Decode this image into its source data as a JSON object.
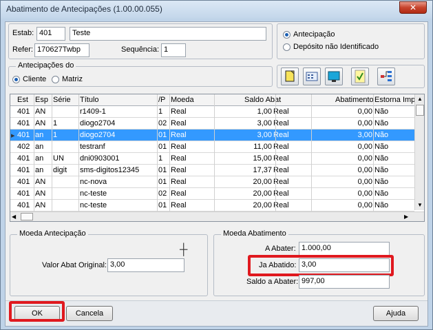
{
  "window": {
    "title": "Abatimento de Antecipações (1.00.00.055)",
    "close_glyph": "✕"
  },
  "header": {
    "estab_label": "Estab:",
    "estab_code": "401",
    "estab_name": "Teste",
    "refer_label": "Refer:",
    "refer_value": "170627Twbp",
    "sequencia_label": "Sequência:",
    "sequencia_value": "1"
  },
  "type_options": [
    {
      "label": "Antecipação",
      "selected": true
    },
    {
      "label": "Depósito não Identificado",
      "selected": false
    }
  ],
  "antecipacoes_do": {
    "title": "Antecipações do",
    "options": [
      {
        "label": "Cliente",
        "selected": true
      },
      {
        "label": "Matriz",
        "selected": false
      }
    ]
  },
  "toolbar": [
    "new-document-icon",
    "calendar-icon",
    "monitor-icon",
    "check-mark-icon",
    "tree-structure-icon"
  ],
  "grid": {
    "columns": [
      "Est",
      "Esp",
      "Série",
      "Título",
      "/P",
      "Moeda",
      "Saldo Abat",
      "Abatimento",
      "Estorna Imp"
    ],
    "rows": [
      [
        "401",
        "AN",
        "",
        "r1409-1",
        "1",
        "Real",
        "1,00",
        "Real",
        "0,00",
        "Não"
      ],
      [
        "401",
        "AN",
        "1",
        "diogo2704",
        "02",
        "Real",
        "3,00",
        "Real",
        "0,00",
        "Não"
      ],
      [
        "401",
        "an",
        "1",
        "diogo2704",
        "01",
        "Real",
        "3,00",
        "Real",
        "3,00",
        "Não"
      ],
      [
        "402",
        "an",
        "",
        "testranf",
        "01",
        "Real",
        "11,00",
        "Real",
        "0,00",
        "Não"
      ],
      [
        "401",
        "an",
        "UN",
        "dni0903001",
        "1",
        "Real",
        "15,00",
        "Real",
        "0,00",
        "Não"
      ],
      [
        "401",
        "an",
        "digit",
        "sms-digitos12345",
        "01",
        "Real",
        "17,37",
        "Real",
        "0,00",
        "Não"
      ],
      [
        "401",
        "AN",
        "",
        "nc-nova",
        "01",
        "Real",
        "20,00",
        "Real",
        "0,00",
        "Não"
      ],
      [
        "401",
        "AN",
        "",
        "nc-teste",
        "02",
        "Real",
        "20,00",
        "Real",
        "0,00",
        "Não"
      ],
      [
        "401",
        "AN",
        "",
        "nc-teste",
        "01",
        "Real",
        "20,00",
        "Real",
        "0,00",
        "Não"
      ]
    ],
    "selected_row": 2,
    "row_indicator": "▸"
  },
  "moeda_antecipacao": {
    "title": "Moeda Antecipação",
    "valor_label": "Valor Abat Original:",
    "valor_value": "3,00"
  },
  "moeda_abatimento": {
    "title": "Moeda Abatimento",
    "a_abater_label": "A Abater:",
    "a_abater_value": "1.000,00",
    "ja_abatido_label": "Ja Abatido:",
    "ja_abatido_value": "3,00",
    "saldo_label": "Saldo a Abater:",
    "saldo_value": "997,00"
  },
  "buttons": {
    "ok": "OK",
    "cancel": "Cancela",
    "help": "Ajuda"
  },
  "colors": {
    "selection": "#3399ff",
    "highlight": "#e0191f"
  }
}
